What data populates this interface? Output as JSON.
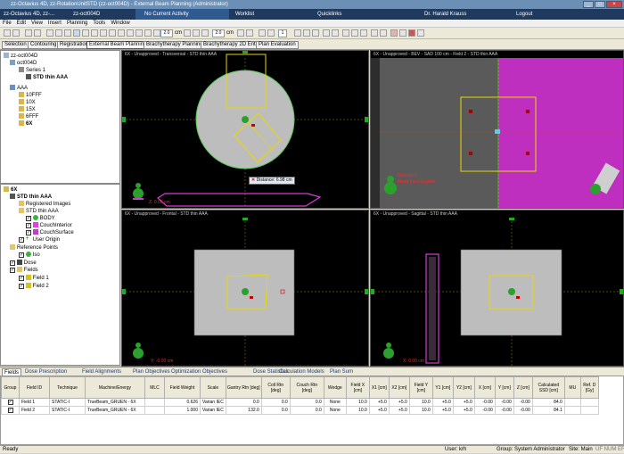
{
  "window": {
    "title": "zz-Octavius 4D, zz-RotationUnitSTD (zz-oct004D) - External Beam Planning (Administrator)"
  },
  "taskbar": {
    "patient1": "zz-Octavius 4D, zz-...",
    "patient2": "zz-oct004D",
    "activity": "No Current Activity",
    "worklist": "Worklist",
    "quicklinks": "Quicklinks",
    "user": "Dr. Harald Krauss",
    "logout": "Logout"
  },
  "menu": [
    "File",
    "Edit",
    "View",
    "Insert",
    "Planning",
    "Tools",
    "Window"
  ],
  "toolbar": {
    "zoom1": "2.0",
    "unit1": "cm",
    "zoom2": "2.0",
    "unit2": "cm",
    "page": "1"
  },
  "workspaces": [
    "Selection",
    "Contouring",
    "Registration",
    "External Beam Planning",
    "Brachytherapy Planning",
    "Brachytherapy 2D Entry",
    "Plan Evaluation"
  ],
  "tree_top": {
    "patient": "zz-oct004D",
    "course": "oct004D",
    "series": "Series 1",
    "image": "STD thin AAA",
    "plan_group": "AAA",
    "energies": [
      "10FFF",
      "10X",
      "15X",
      "6FFF",
      "6X"
    ]
  },
  "tree_bottom": {
    "root": "6X",
    "plan": "STD thin AAA",
    "registered": "Registered Images",
    "structure_set": "STD thin AAA",
    "structures": [
      "BODY",
      "CouchInterior",
      "CouchSurface"
    ],
    "origin": "User Origin",
    "ref_points": "Reference Points",
    "iso": "Iso",
    "dose": "Dose",
    "fields": "Fields",
    "field_items": [
      "Field 1",
      "Field 2"
    ]
  },
  "viewports": {
    "transversal": "6X  -  Unapproved - Transversal - STD thin AAA",
    "bev": "6X  -  Unapproved - BEV  -  SAD 100 cm  -  Field 2 - STD thin AAA",
    "frontal": "6X  -  Unapproved - Frontal - STD thin AAA",
    "sagittal": "6X  -  Unapproved - Sagittal - STD thin AAA",
    "distance": "Distance: 6.98 cm",
    "z_coord": "Z: 0.00 cm",
    "y_coord": "Y: -0.00 cm",
    "x_coord": "X: 0.00 cm",
    "std_label": "Standard",
    "hfs_label": "Head First-Supine",
    "iso_label": "Iso"
  },
  "bottom_tabs": [
    "Fields",
    "Dose Prescription",
    "Field Alignments",
    "Plan Objectives",
    "Optimization Objectives",
    "Dose Statistics",
    "Calculation Models",
    "Plan Sum"
  ],
  "table": {
    "headers": [
      "Group",
      "Field ID",
      "Technique",
      "Machine/Energy",
      "MLC",
      "Field Weight",
      "Scale",
      "Gantry Rtn [deg]",
      "Coll Rtn [deg]",
      "Couch Rtn [deg]",
      "Wedge",
      "Field X [cm]",
      "X1 [cm]",
      "X2 [cm]",
      "Field Y [cm]",
      "Y1 [cm]",
      "Y2 [cm]",
      "X [cm]",
      "Y [cm]",
      "Z [cm]",
      "Calculated SSD [cm]",
      "MU",
      "Ref. D [Gy]"
    ],
    "rows": [
      [
        "",
        "Field 1",
        "STATIC-I",
        "TrueBeam_GRUEN - 6X",
        "",
        "0.626",
        "Varian IEC",
        "0.0",
        "0.0",
        "0.0",
        "None",
        "10.0",
        "+5.0",
        "+5.0",
        "10.0",
        "+5.0",
        "+5.0",
        "-0.00",
        "-0.00",
        "-0.00",
        "84.0",
        "",
        ""
      ],
      [
        "",
        "Field 2",
        "STATIC-I",
        "TrueBeam_GRUEN - 6X",
        "",
        "1.000",
        "Varian IEC",
        "132.0",
        "0.0",
        "0.0",
        "None",
        "10.0",
        "+5.0",
        "+5.0",
        "10.0",
        "+5.0",
        "+5.0",
        "-0.00",
        "-0.00",
        "-0.00",
        "84.1",
        "",
        ""
      ]
    ]
  },
  "status": {
    "left": "Ready",
    "user": "User: krh",
    "group": "Group: System Administrator",
    "site": "Site: Main",
    "caps": "UF  NUM  EF"
  }
}
